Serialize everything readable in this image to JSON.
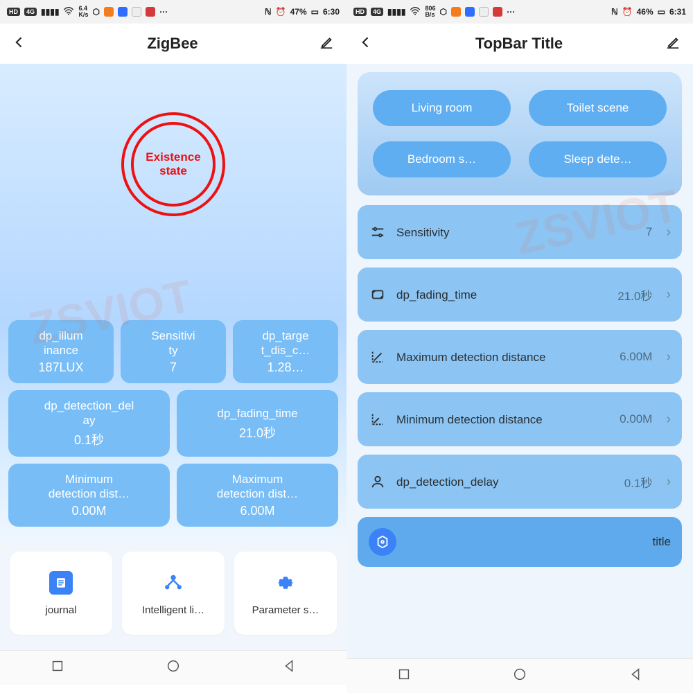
{
  "left": {
    "status": {
      "net": "6.4\nK/s",
      "battery": "47%",
      "time": "6:30"
    },
    "topbar": {
      "title": "ZigBee"
    },
    "state_label": "Existence\nstate",
    "cards": {
      "r1": [
        {
          "label": "dp_illum\ninance",
          "value": "187LUX"
        },
        {
          "label": "Sensitivi\nty",
          "value": "7"
        },
        {
          "label": "dp_targe\nt_dis_c…",
          "value": "1.28…"
        }
      ],
      "r2": [
        {
          "label": "dp_detection_del\nay",
          "value": "0.1秒"
        },
        {
          "label": "dp_fading_time",
          "value": "21.0秒"
        }
      ],
      "r3": [
        {
          "label": "Minimum\ndetection dist…",
          "value": "0.00M"
        },
        {
          "label": "Maximum\ndetection dist…",
          "value": "6.00M"
        }
      ]
    },
    "actions": [
      "journal",
      "Intelligent li…",
      "Parameter s…"
    ]
  },
  "right": {
    "status": {
      "net": "806\nB/s",
      "battery": "46%",
      "time": "6:31"
    },
    "topbar": {
      "title": "TopBar Title"
    },
    "scenes": [
      "Living room",
      "Toilet scene",
      "Bedroom s…",
      "Sleep dete…"
    ],
    "settings": [
      {
        "label": "Sensitivity",
        "value": "7"
      },
      {
        "label": "dp_fading_time",
        "value": "21.0秒"
      },
      {
        "label": "Maximum detection distance",
        "value": "6.00M"
      },
      {
        "label": "Minimum detection distance",
        "value": "0.00M"
      },
      {
        "label": "dp_detection_delay",
        "value": "0.1秒"
      }
    ],
    "title_row": "title"
  },
  "hd_badge": "HD",
  "lte_badge": "4G"
}
